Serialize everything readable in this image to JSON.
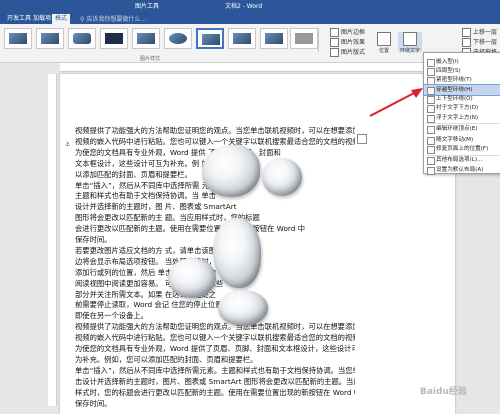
{
  "window": {
    "picture_tools": "图片工具",
    "title": "文档2 - Word"
  },
  "tabs": [
    "开发工具",
    "加载项",
    "格式"
  ],
  "active_tab": "格式",
  "tellme_placeholder": "告诉我你想要做什么…",
  "ribbon": {
    "picture_border": "图片边框",
    "picture_effects": "图片效果",
    "picture_layout": "图片版式",
    "styles_group": "图片样式",
    "position": "位置",
    "wrap_text": "环绕文字",
    "bring_forward": "上移一层",
    "send_backward": "下移一层",
    "selection_pane": "选择窗格"
  },
  "wrap_menu": {
    "items": [
      {
        "label": "嵌入型(I)",
        "icon": "inline-icon"
      },
      {
        "label": "四周型(S)",
        "icon": "square-wrap-icon"
      },
      {
        "label": "紧密型环绕(T)",
        "icon": "tight-wrap-icon"
      },
      {
        "label": "穿越型环绕(H)",
        "icon": "through-wrap-icon",
        "highlight": true
      },
      {
        "label": "上下型环绕(O)",
        "icon": "top-bottom-wrap-icon"
      },
      {
        "label": "衬于文字下方(D)",
        "icon": "behind-text-icon"
      },
      {
        "label": "浮于文字上方(N)",
        "icon": "in-front-text-icon"
      },
      {
        "label": "编辑环绕顶点(E)",
        "icon": "edit-wrap-points-icon"
      },
      {
        "label": "随文字移动(M)",
        "icon": "move-with-text-icon"
      },
      {
        "label": "修复页面上的位置(F)",
        "icon": "fix-position-icon"
      },
      {
        "label": "其他布局选项(L)...",
        "icon": "more-layout-icon"
      },
      {
        "label": "设置为默认布局(A)",
        "icon": "set-default-icon"
      }
    ]
  },
  "document": {
    "lines": [
      "视频提供了功能强大的方法帮助您证明您的观点。当您单击联机视频时，可以在想要添加的",
      "视频的嵌入代码中进行粘贴。您也可以键入一个关键字以联机搜索最适合您的文档的视频。",
      "为使您的文档具有专业外观，Word 提供                        了页眉、页脚、封面和",
      "文本框设计，这些设计可互为补充。例                              如，您可",
      "以添加匹配的封面、页眉和提要栏。",
      "单击“插入”，然后从不同库中选择所需                                   元素。",
      "主题和样式也有助于文档保持协调。当                                   单击",
      "设计并选择新的主题时，图                                        片、图表或 SmartArt",
      "图形将会更改以匹配新的主                                      题。当应用样式时，您的标题",
      "会进行更改以匹配新的主题。使用在需要位置                    出现的新按钮在 Word 中",
      "保存时间。",
      "若要更改图片适应文档的方                                   式，请单击该图片，图片旁",
      "边将会显示布局选项按钮。                                   当处理表格时，单击要",
      "添加行或列的位置，然后                                         单击加号。在新的",
      "阅读视图中阅读更加容易。                                     可以折叠文档某些",
      "部分并关注所需文本。如果                                    在达到结尾处之",
      "前需要停止读取，Word 会记                                   住您的停止位置 -",
      "即使在另一个设备上。",
      "视频提供了功能强大的方法帮助您证明您的观点。当您单击联机视频时，可以在想要添加的",
      "视频的嵌入代码中进行粘贴。您也可以键入一个关键字以联机搜索最适合您的文档的视频。",
      "为使您的文档具有专业外观，Word 提供了页眉、页脚、封面和文本框设计，这些设计可互",
      "为补充。例如，您可以添加匹配的封面、页眉和提要栏。",
      "单击“插入”，然后从不同库中选择所需元素。主题和样式也有助于文档保持协调。当您单",
      "击设计并选择新的主题时，图片、图表或 SmartArt 图形将会更改以匹配新的主题。当应用",
      "样式时，您的标题会进行更改以匹配新的主题。使用在需要位置出现的新按钮在 Word 中",
      "保存时间。"
    ]
  },
  "watermark": "Baidu经验",
  "colors": {
    "accent": "#2b579a",
    "highlight": "#c5d5ee",
    "arrow": "#e0202a"
  }
}
